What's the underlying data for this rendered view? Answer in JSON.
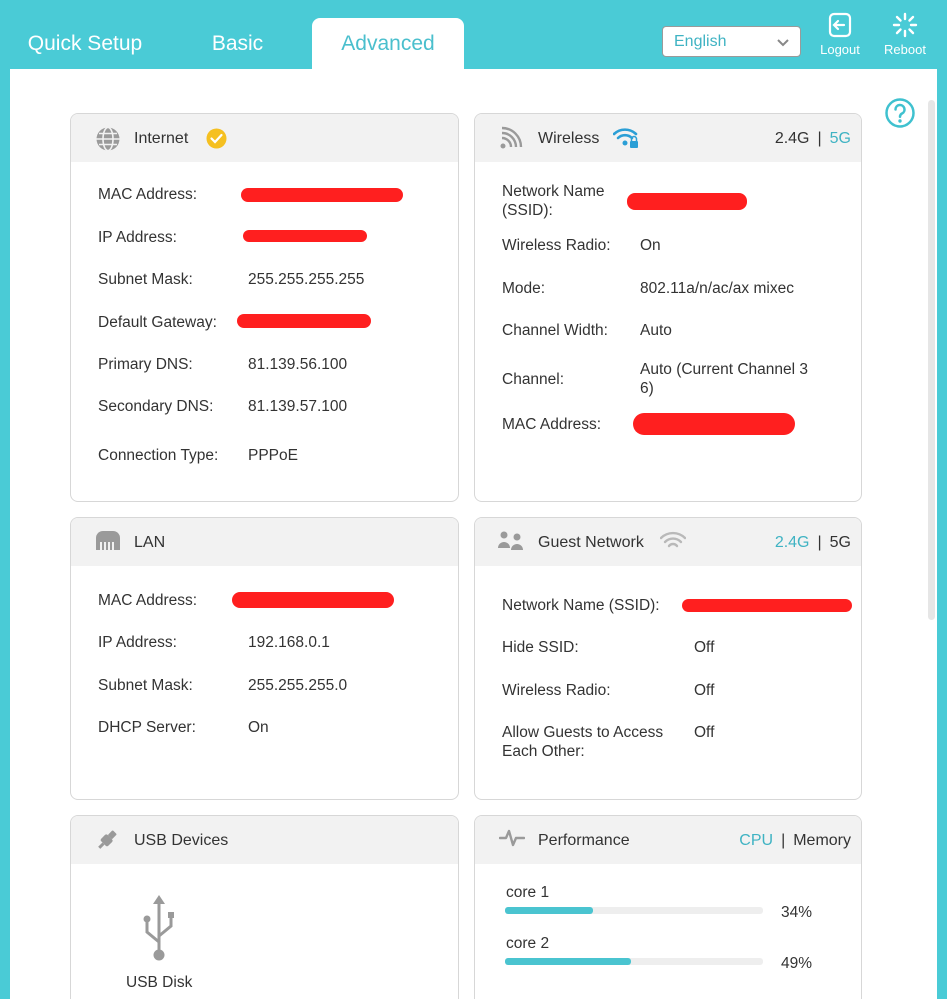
{
  "tabs": {
    "quick_setup": "Quick Setup",
    "basic": "Basic",
    "advanced": "Advanced"
  },
  "language": {
    "selected": "English"
  },
  "top_actions": {
    "logout": "Logout",
    "reboot": "Reboot"
  },
  "internet": {
    "title": "Internet",
    "mac_label": "MAC Address:",
    "ip_label": "IP Address:",
    "subnet_label": "Subnet Mask:",
    "subnet_value": "255.255.255.255",
    "gateway_label": "Default Gateway:",
    "primary_dns_label": "Primary DNS:",
    "primary_dns_value": "81.139.56.100",
    "secondary_dns_label": "Secondary DNS:",
    "secondary_dns_value": "81.139.57.100",
    "conn_type_label": "Connection Type:",
    "conn_type_value": "PPPoE"
  },
  "wireless": {
    "title": "Wireless",
    "band_24": "2.4G",
    "band_sep": "|",
    "band_5": "5G",
    "active_band": "5G",
    "ssid_label_1": "Network Name",
    "ssid_label_2": "(SSID):",
    "radio_label": "Wireless Radio:",
    "radio_value": "On",
    "mode_label": "Mode:",
    "mode_value": "802.11a/n/ac/ax mixec",
    "width_label": "Channel Width:",
    "width_value": "Auto",
    "channel_label": "Channel:",
    "channel_value_1": "Auto (Current Channel 3",
    "channel_value_2": "6)",
    "mac_label": "MAC Address:"
  },
  "lan": {
    "title": "LAN",
    "mac_label": "MAC Address:",
    "ip_label": "IP Address:",
    "ip_value": "192.168.0.1",
    "subnet_label": "Subnet Mask:",
    "subnet_value": "255.255.255.0",
    "dhcp_label": "DHCP Server:",
    "dhcp_value": "On"
  },
  "guest": {
    "title": "Guest Network",
    "band_24": "2.4G",
    "band_sep": "|",
    "band_5": "5G",
    "active_band": "2.4G",
    "ssid_label": "Network Name (SSID):",
    "hide_label": "Hide SSID:",
    "hide_value": "Off",
    "radio_label": "Wireless Radio:",
    "radio_value": "Off",
    "allow_label_1": "Allow Guests to Access",
    "allow_label_2": "Each Other:",
    "allow_value": "Off"
  },
  "usb": {
    "title": "USB Devices",
    "device_label": "USB Disk"
  },
  "performance": {
    "title": "Performance",
    "toggle_cpu": "CPU",
    "toggle_sep": "|",
    "toggle_memory": "Memory",
    "active_toggle": "CPU",
    "cores": [
      {
        "label": "core 1",
        "percent_text": "34%",
        "value": 34
      },
      {
        "label": "core 2",
        "percent_text": "49%",
        "value": 49
      }
    ]
  },
  "colors": {
    "accent": "#4acbd6",
    "accent_text": "#3fb3c3",
    "badge": "#f5c021",
    "redaction": "#ff1f1f"
  }
}
